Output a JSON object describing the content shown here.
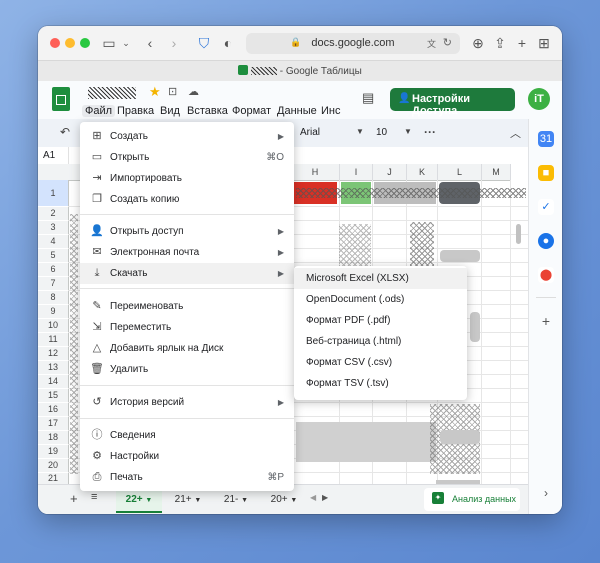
{
  "browser": {
    "url": "docs.google.com",
    "tab_title": "- Google Таблицы"
  },
  "sheets": {
    "menubar": [
      "Файл",
      "Правка",
      "Вид",
      "Вставка",
      "Формат",
      "Данные",
      "Инс"
    ],
    "share_button": "Настройки Доступа",
    "avatar_initials": "iT",
    "toolbar": {
      "font": "Arial",
      "font_size": "10",
      "more": "···"
    },
    "cell_ref": "A1",
    "columns": [
      "H",
      "I",
      "J",
      "K",
      "L",
      "M"
    ],
    "rows": [
      "1",
      "2",
      "3",
      "4",
      "5",
      "6",
      "7",
      "8",
      "9",
      "10",
      "11",
      "12",
      "13",
      "14",
      "15",
      "16",
      "17",
      "18",
      "19",
      "20",
      "21"
    ],
    "sheet_tabs": [
      "22+",
      "21+",
      "21-",
      "20+"
    ],
    "explore": "Анализ данных"
  },
  "file_menu": {
    "items": [
      {
        "icon": "plus-square-icon",
        "glyph": "⊞",
        "label": "Создать",
        "submenu": true
      },
      {
        "icon": "folder-icon",
        "glyph": "▭",
        "label": "Открыть",
        "shortcut": "⌘O"
      },
      {
        "icon": "import-icon",
        "glyph": "⇥",
        "label": "Импортировать"
      },
      {
        "icon": "copy-icon",
        "glyph": "❐",
        "label": "Создать копию"
      },
      {
        "icon": "add-person-icon",
        "glyph": "👤",
        "label": "Открыть доступ",
        "submenu": true
      },
      {
        "icon": "mail-icon",
        "glyph": "✉",
        "label": "Электронная почта",
        "submenu": true
      },
      {
        "icon": "download-icon",
        "glyph": "⤓",
        "label": "Скачать",
        "submenu": true
      },
      {
        "icon": "rename-icon",
        "glyph": "✎",
        "label": "Переименовать"
      },
      {
        "icon": "move-icon",
        "glyph": "⇲",
        "label": "Переместить"
      },
      {
        "icon": "drive-shortcut-icon",
        "glyph": "△",
        "label": "Добавить ярлык на Диск"
      },
      {
        "icon": "trash-icon",
        "glyph": "🗑",
        "label": "Удалить"
      },
      {
        "icon": "history-icon",
        "glyph": "↺",
        "label": "История версий",
        "submenu": true
      },
      {
        "icon": "info-icon",
        "glyph": "ⓘ",
        "label": "Сведения"
      },
      {
        "icon": "settings-icon",
        "glyph": "⚙",
        "label": "Настройки"
      },
      {
        "icon": "print-icon",
        "glyph": "⎙",
        "label": "Печать",
        "shortcut": "⌘P"
      }
    ]
  },
  "download_submenu": {
    "items": [
      "Microsoft Excel (XLSX)",
      "OpenDocument (.ods)",
      "Формат PDF (.pdf)",
      "Веб-страница (.html)",
      "Формат CSV (.csv)",
      "Формат TSV (.tsv)"
    ]
  },
  "colors": {
    "sheets_green": "#1e7a3c",
    "accent_red": "#d93025",
    "accent_green": "#7cc576",
    "menu_hover": "#f1f1f1"
  }
}
